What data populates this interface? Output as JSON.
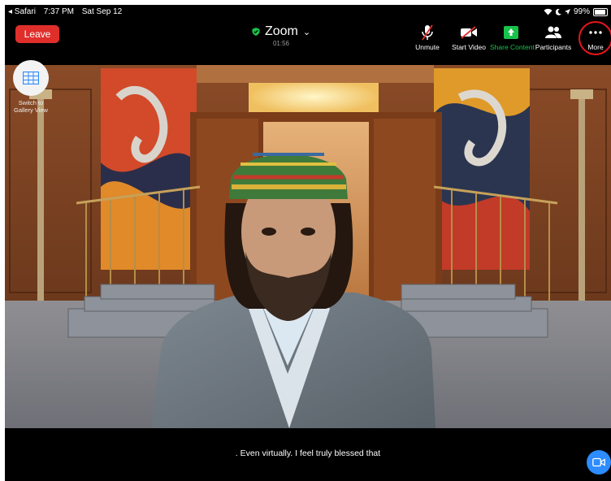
{
  "status_bar": {
    "back_app": "◂ Safari",
    "time": "7:37 PM",
    "date": "Sat Sep 12",
    "battery": "99%"
  },
  "toolbar": {
    "leave_label": "Leave",
    "meeting_title": "Zoom",
    "timer": "01:56",
    "unmute_label": "Unmute",
    "start_video_label": "Start Video",
    "share_content_label": "Share Content",
    "participants_label": "Participants",
    "more_label": "More"
  },
  "gallery": {
    "label": "Switch to Gallery View"
  },
  "caption": {
    "text": ".  Even virtually.  I feel truly blessed that"
  },
  "colors": {
    "leave": "#e02f2b",
    "share": "#19c24a",
    "highlight_ring": "#e8151b",
    "chat_button": "#2d8cff"
  }
}
